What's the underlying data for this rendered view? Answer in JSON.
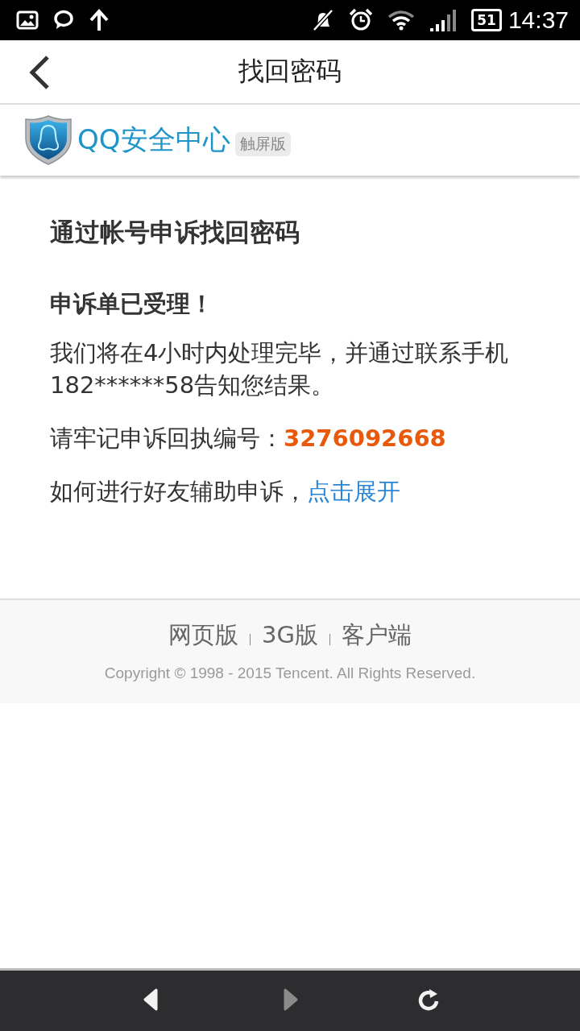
{
  "status_bar": {
    "battery": "51",
    "time": "14:37"
  },
  "header": {
    "title": "找回密码"
  },
  "brand": {
    "name": "QQ安全中心",
    "badge": "触屏版"
  },
  "content": {
    "heading": "通过帐号申诉找回密码",
    "status": "申诉单已受理！",
    "message": "我们将在4小时内处理完毕，并通过联系手机182******58告知您结果。",
    "receipt": "请牢记申诉回执编号：**3276092668**",
    "help": {
      "text": "如何进行好友辅助申诉，",
      "link": "点击展开"
    }
  },
  "footer": {
    "links": [
      "网页版",
      "3G版",
      "客户端"
    ],
    "copyright": "Copyright © 1998 - 2015 Tencent. All Rights Reserved."
  },
  "browser_bar": {
    "buttons": [
      {
        "kind": "back",
        "disabled": false
      },
      {
        "kind": "forward",
        "disabled": true
      },
      {
        "kind": "reload",
        "disabled": false
      }
    ]
  }
}
